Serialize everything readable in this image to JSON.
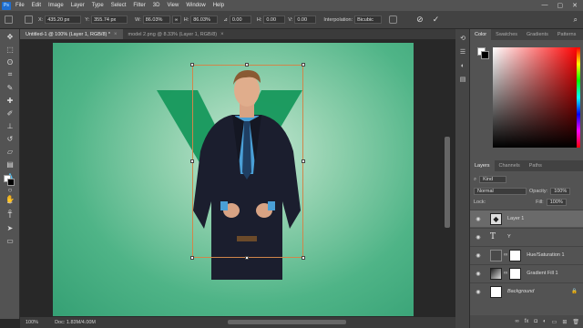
{
  "menu": [
    "File",
    "Edit",
    "Image",
    "Layer",
    "Type",
    "Select",
    "Filter",
    "3D",
    "View",
    "Window",
    "Help"
  ],
  "app_logo": "Ps",
  "window_buttons": [
    "—",
    "▢",
    "✕"
  ],
  "options": {
    "x_label": "X:",
    "x_value": "435.20 px",
    "y_label": "Y:",
    "y_value": "355.74 px",
    "w_label": "W:",
    "w_value": "86.03%",
    "h_label": "H:",
    "h_value": "86.03%",
    "rot_value": "0.00",
    "hskew_label": "H:",
    "hskew_value": "0.00",
    "vskew_label": "V:",
    "vskew_value": "0.00",
    "interp_label": "Interpolation:",
    "interp_value": "Bicubic"
  },
  "tabs": [
    {
      "label": "Untitled-1 @ 100% (Layer 1, RGB/8) *",
      "close": "×"
    },
    {
      "label": "model 2.png @ 8.33% (Layer 1, RGB/8)",
      "close": "×"
    }
  ],
  "canvas": {
    "big_letter": "Y",
    "bg_color": "#3aa97a"
  },
  "status": {
    "zoom": "100%",
    "doc": "Doc: 1.83M/4.00M"
  },
  "color_panel": {
    "tabs": [
      "Color",
      "Swatches",
      "Gradients",
      "Patterns"
    ]
  },
  "layers_panel": {
    "tabs": [
      "Layers",
      "Channels",
      "Paths"
    ],
    "kind_label": "Kind",
    "blend_mode": "Normal",
    "opacity_label": "Opacity:",
    "opacity_value": "100%",
    "lock_label": "Lock:",
    "fill_label": "Fill:",
    "fill_value": "100%",
    "layers": [
      {
        "name": "Layer 1",
        "type": "pixel",
        "selected": true
      },
      {
        "name": "Y",
        "type": "text",
        "selected": false
      },
      {
        "name": "Hue/Saturation 1",
        "type": "adjustment",
        "selected": false
      },
      {
        "name": "Gradient Fill 1",
        "type": "fill",
        "selected": false
      },
      {
        "name": "Background",
        "type": "background",
        "selected": false
      }
    ],
    "footer_icons": [
      "link-icon",
      "fx-icon",
      "mask-icon",
      "adjustment-icon",
      "folder-icon",
      "new-layer-icon",
      "trash-icon"
    ]
  },
  "tools": [
    "move-icon",
    "marquee-icon",
    "lasso-icon",
    "crop-icon",
    "eyedropper-icon",
    "healing-icon",
    "brush-icon",
    "stamp-icon",
    "history-brush-icon",
    "eraser-icon",
    "gradient-icon",
    "blur-icon",
    "dodge-icon",
    "pen-icon",
    "type-icon",
    "path-select-icon",
    "shape-icon",
    "hand-icon",
    "zoom-icon"
  ]
}
